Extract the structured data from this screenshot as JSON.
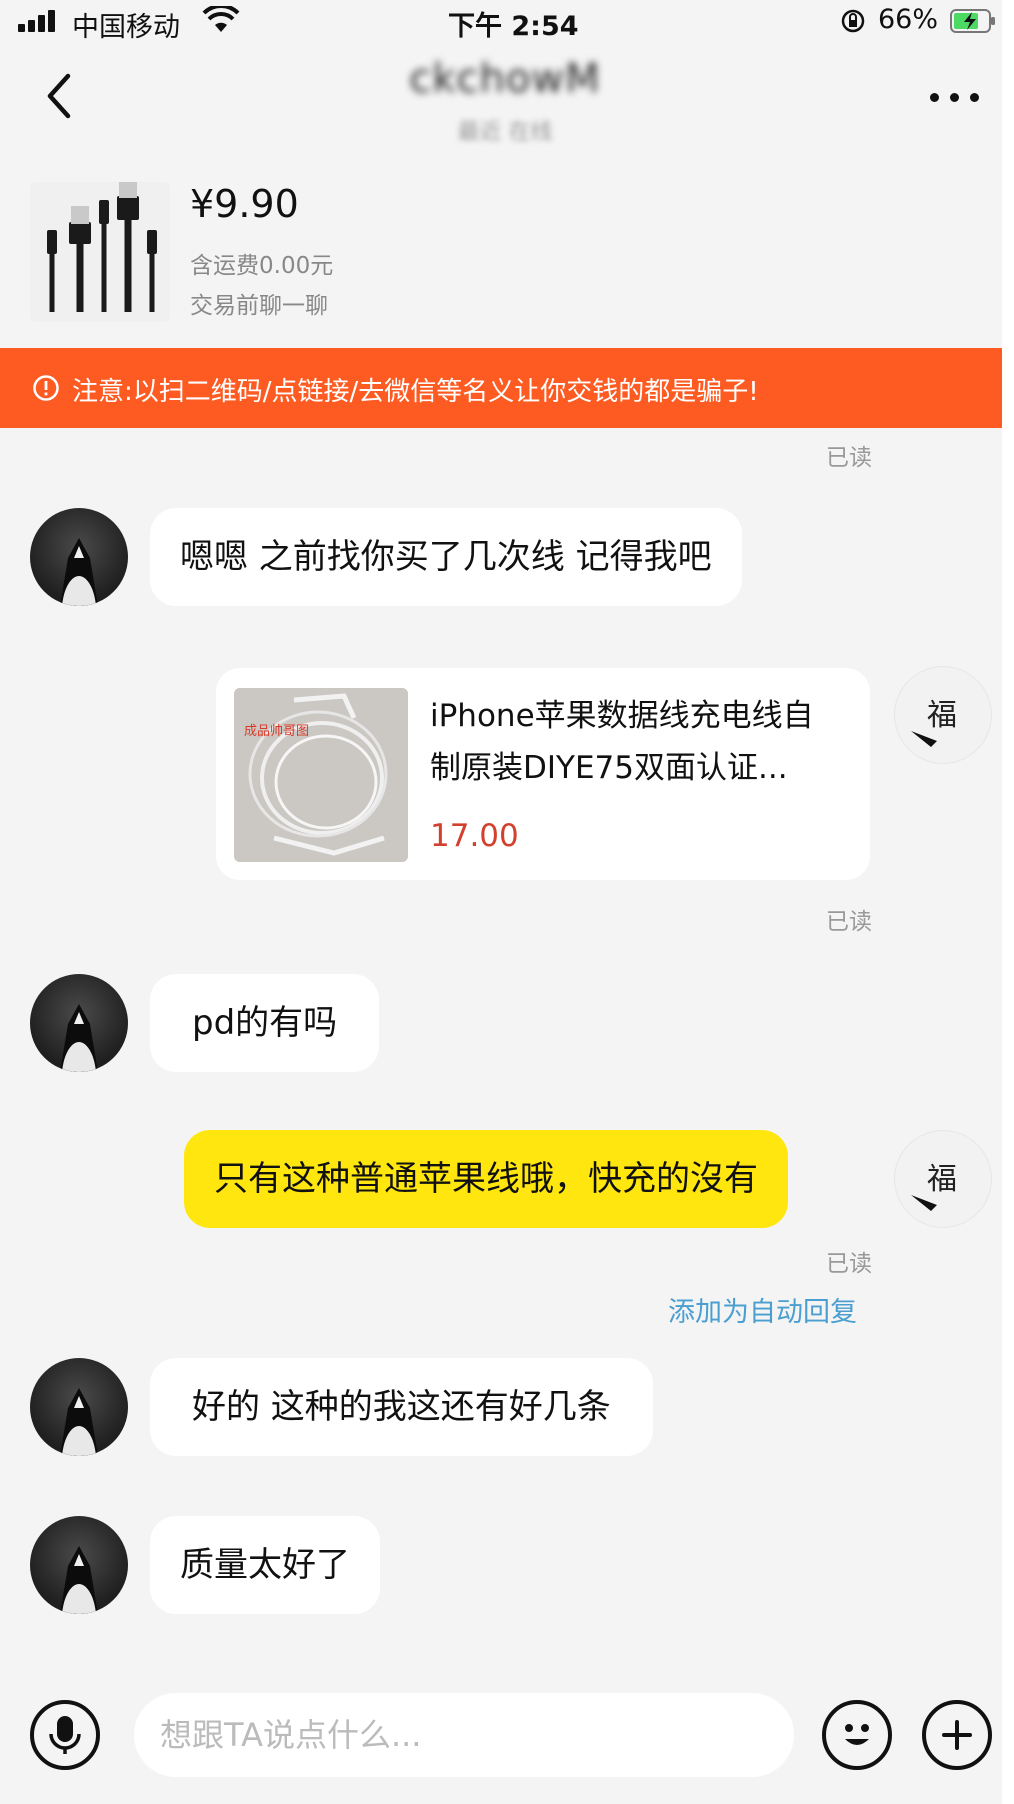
{
  "status_bar": {
    "carrier": "中国移动",
    "time": "下午 2:54",
    "battery_pct": "66%"
  },
  "header": {
    "title": "ckchowM",
    "subtitle": "最近 在线"
  },
  "product": {
    "price": "¥9.90",
    "shipping": "含运费0.00元",
    "chat_note": "交易前聊一聊"
  },
  "warning": {
    "text": "注意:以扫二维码/点链接/去微信等名义让你交钱的都是骗子!"
  },
  "messages": {
    "read_label": "已读",
    "m1": "嗯嗯 之前找你买了几次线 记得我吧",
    "link_card": {
      "title_line1": "iPhone苹果数据线充电线自",
      "title_line2": "制原装DIYE75双面认证...",
      "price": "17.00",
      "thumb_caption": "成品帅哥图"
    },
    "m2": "pd的有吗",
    "m3": "只有这种普通苹果线哦，快充的沒有",
    "auto_reply": "添加为自动回复",
    "m4": "好的 这种的我这还有好几条",
    "m5": "质量太好了"
  },
  "input_bar": {
    "placeholder": "想跟TA说点什么..."
  },
  "colors": {
    "warning_bg": "#fd5b22",
    "my_bubble": "#ffe60f",
    "price_red": "#d2412d",
    "link_blue": "#4a9fd0"
  }
}
